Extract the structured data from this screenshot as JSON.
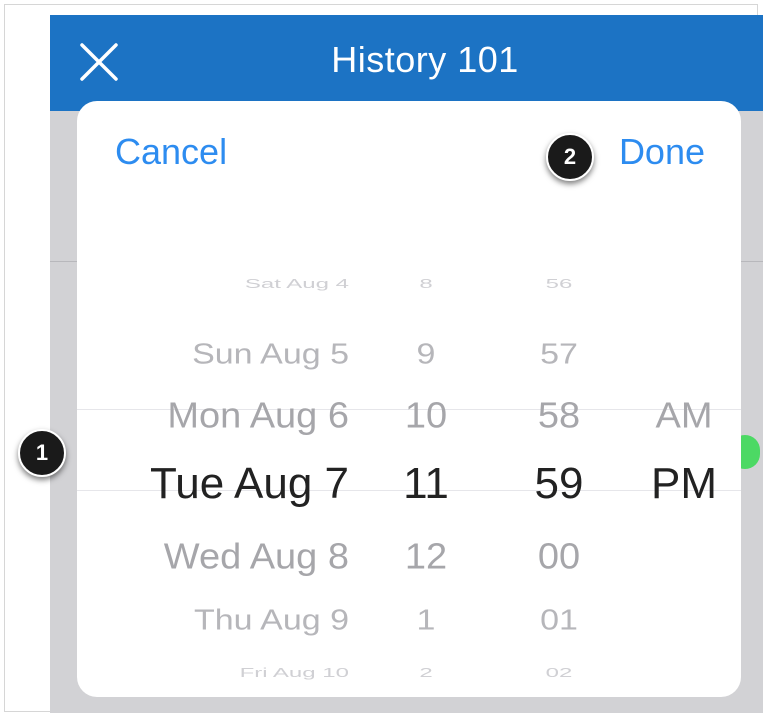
{
  "header": {
    "title": "History 101",
    "close_icon": "close-icon"
  },
  "sheet": {
    "cancel_label": "Cancel",
    "done_label": "Done"
  },
  "picker": {
    "dates": [
      "Sat Aug 4",
      "Sun Aug 5",
      "Mon Aug 6",
      "Tue Aug 7",
      "Wed Aug 8",
      "Thu Aug 9",
      "Fri Aug 10"
    ],
    "hours": [
      "8",
      "9",
      "10",
      "11",
      "12",
      "1",
      "2"
    ],
    "minutes": [
      "56",
      "57",
      "58",
      "59",
      "00",
      "01",
      "02"
    ],
    "ampm": [
      "AM",
      "PM"
    ],
    "selected": {
      "date": "Tue Aug 7",
      "hour": "11",
      "minute": "59",
      "ampm": "PM"
    }
  },
  "callouts": [
    "1",
    "2"
  ],
  "colors": {
    "navbar": "#1c73c4",
    "link": "#2d8cf0",
    "toggle": "#4cd964"
  }
}
